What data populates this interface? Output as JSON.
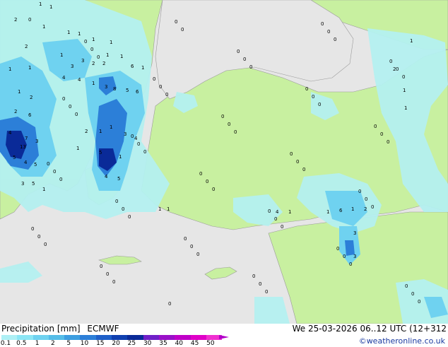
{
  "header": {
    "precipitation_label": "Precipitation [mm]",
    "model_label": "ECMWF",
    "valid_time": "We 25-03-2026 06..12 UTC (12+312",
    "credit": "©weatheronline.co.uk"
  },
  "legend": {
    "ticks": [
      "0.1",
      "0.5",
      "1",
      "2",
      "5",
      "10",
      "15",
      "20",
      "25",
      "30",
      "35",
      "40",
      "45",
      "50"
    ],
    "colors": [
      "#aef0f5",
      "#8ce6f5",
      "#6fd2f0",
      "#55bde8",
      "#3d9ee0",
      "#2c7fd8",
      "#1e5fc8",
      "#1040b0",
      "#0a2a98",
      "#7020c8",
      "#9a10c8",
      "#c000c8",
      "#e000c8",
      "#f030d0"
    ]
  },
  "colors": {
    "sea": "#e6e6e6",
    "land_dry": "#c8f0a0",
    "light_precip": "#b4f0f0",
    "moderate_precip": "#6fd2f0",
    "heavy_precip": "#2c7fd8",
    "very_heavy_precip": "#0a2a98"
  },
  "map_values": [
    "2",
    "1",
    "1",
    "1",
    "1",
    "1",
    "1",
    "1",
    "1",
    "1",
    "2",
    "1",
    "1",
    "3",
    "3",
    "2",
    "2",
    "6",
    "1",
    "4",
    "4",
    "1",
    "3",
    "8",
    "5",
    "6",
    "1",
    "2",
    "2",
    "6",
    "4",
    "7",
    "3",
    "13",
    "5",
    "4",
    "5",
    "1",
    "3",
    "4",
    "1",
    "2",
    "1",
    "5",
    "1",
    "4",
    "5",
    "3",
    "5",
    "1",
    "2",
    "1",
    "6",
    "1",
    "3",
    "3",
    "4",
    "1",
    "1",
    "1",
    "2",
    "1",
    "1",
    "1",
    "1"
  ],
  "map_zeros_count": 70
}
